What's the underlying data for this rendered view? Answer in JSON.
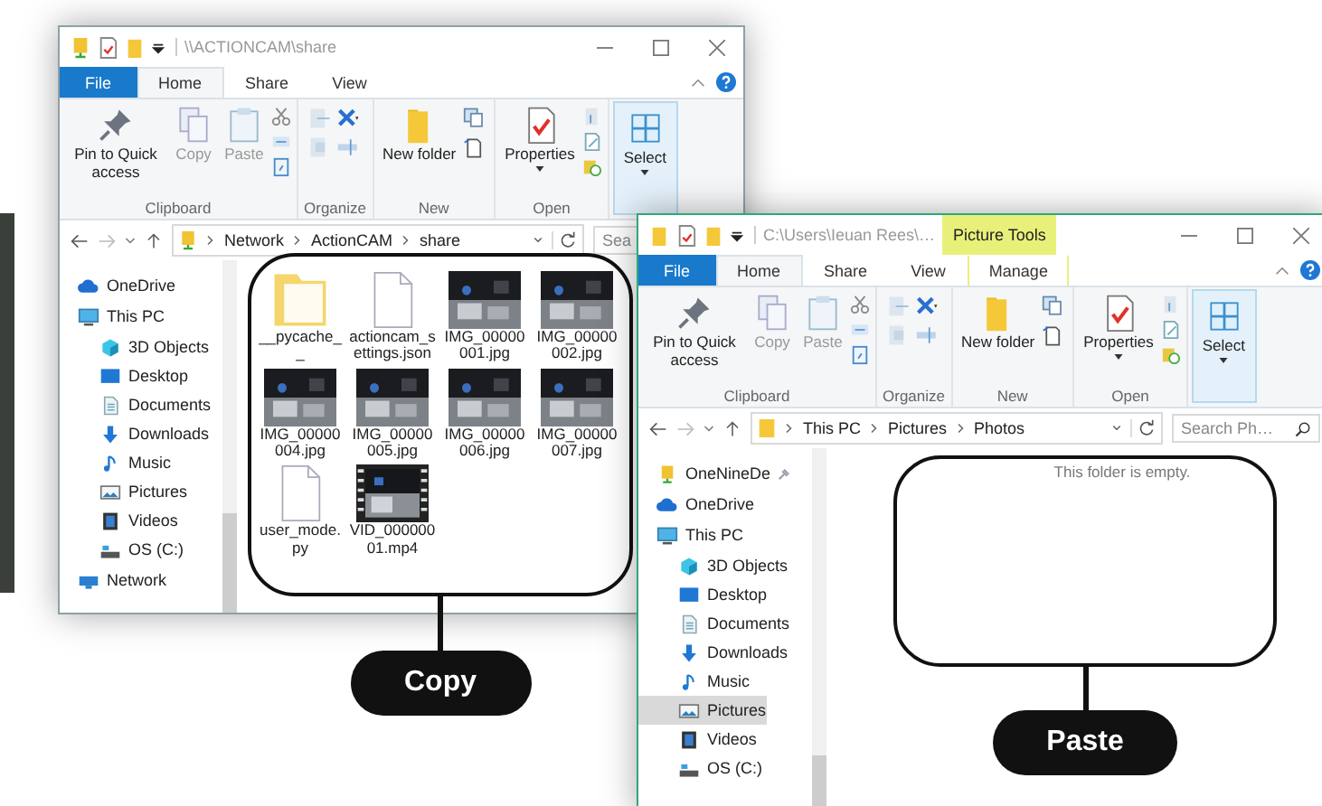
{
  "windows": [
    {
      "title": "\\\\ACTIONCAM\\share",
      "tabs": [
        {
          "label": "File",
          "kind": "file",
          "selected": false
        },
        {
          "label": "Home",
          "kind": "tab",
          "selected": true
        },
        {
          "label": "Share",
          "kind": "tab",
          "selected": false
        },
        {
          "label": "View",
          "kind": "tab",
          "selected": false
        }
      ],
      "ribbon": [
        {
          "kind": "clipboard",
          "label": "Clipboard",
          "commands": [
            {
              "label": "Pin to Quick access",
              "disabled": false
            },
            {
              "label": "Copy",
              "disabled": true
            },
            {
              "label": "Paste",
              "disabled": true
            }
          ]
        },
        {
          "kind": "organize",
          "label": "Organize"
        },
        {
          "kind": "new",
          "label": "New",
          "commands": [
            {
              "label": "New folder",
              "disabled": false
            }
          ]
        },
        {
          "kind": "open",
          "label": "Open",
          "commands": [
            {
              "label": "Properties",
              "disabled": false
            }
          ]
        },
        {
          "kind": "select",
          "commands": [
            {
              "label": "Select",
              "disabled": false
            }
          ]
        }
      ],
      "address": {
        "crumbs": [
          "Network",
          "ActionCAM",
          "share"
        ]
      },
      "search": {
        "placeholder": "Sea"
      },
      "sidebar": [
        {
          "label": "OneDrive",
          "kind": "cloud",
          "selected": false
        },
        {
          "label": "This PC",
          "kind": "computer",
          "selected": false,
          "children": [
            {
              "label": "3D Objects",
              "kind": "cube",
              "selected": false
            },
            {
              "label": "Desktop",
              "kind": "desktop",
              "selected": false
            },
            {
              "label": "Documents",
              "kind": "document",
              "selected": false
            },
            {
              "label": "Downloads",
              "kind": "download",
              "selected": false
            },
            {
              "label": "Music",
              "kind": "music",
              "selected": false
            },
            {
              "label": "Pictures",
              "kind": "pictures",
              "selected": false
            },
            {
              "label": "Videos",
              "kind": "videos",
              "selected": false
            },
            {
              "label": "OS (C:)",
              "kind": "drive",
              "selected": false
            }
          ]
        },
        {
          "label": "Network",
          "kind": "network",
          "selected": false
        }
      ],
      "files": [
        {
          "name": "__pycache__",
          "kind": "folder"
        },
        {
          "name": "actioncam_settings.json",
          "kind": "file"
        },
        {
          "name": "IMG_00000001.jpg"
        },
        {
          "name": "IMG_00000002.jpg"
        },
        {
          "name": "IMG_00000004.jpg"
        },
        {
          "name": "IMG_00000005.jpg"
        },
        {
          "name": "IMG_00000006.jpg"
        },
        {
          "name": "IMG_00000007.jpg"
        },
        {
          "name": "user_mode.py",
          "kind": "file"
        },
        {
          "name": "VID_00000001.mp4",
          "kind": "video"
        }
      ],
      "callout": {
        "label": "Copy"
      }
    },
    {
      "title": "C:\\Users\\Ieuan Rees\\…",
      "context_label": "Picture Tools",
      "tabs": [
        {
          "label": "File",
          "kind": "file",
          "selected": false
        },
        {
          "label": "Home",
          "kind": "tab",
          "selected": true
        },
        {
          "label": "Share",
          "kind": "tab",
          "selected": false
        },
        {
          "label": "View",
          "kind": "tab",
          "selected": false
        },
        {
          "label": "Manage",
          "kind": "context",
          "selected": false
        }
      ],
      "ribbon": [
        {
          "kind": "clipboard",
          "label": "Clipboard",
          "commands": [
            {
              "label": "Pin to Quick access",
              "disabled": false
            },
            {
              "label": "Copy",
              "disabled": true
            },
            {
              "label": "Paste",
              "disabled": true
            }
          ]
        },
        {
          "kind": "organize",
          "label": "Organize"
        },
        {
          "kind": "new",
          "label": "New",
          "commands": [
            {
              "label": "New folder",
              "disabled": false
            }
          ]
        },
        {
          "kind": "open",
          "label": "Open",
          "commands": [
            {
              "label": "Properties",
              "disabled": false
            }
          ]
        },
        {
          "kind": "select",
          "commands": [
            {
              "label": "Select",
              "disabled": false
            }
          ]
        }
      ],
      "address": {
        "crumbs": [
          "This PC",
          "Pictures",
          "Photos"
        ]
      },
      "search": {
        "placeholder": "Search Ph…"
      },
      "sidebar": [
        {
          "label": "OneNineDe",
          "kind": "pinned",
          "selected": false
        },
        {
          "label": "OneDrive",
          "kind": "cloud",
          "selected": false
        },
        {
          "label": "This PC",
          "kind": "computer",
          "selected": false,
          "children": [
            {
              "label": "3D Objects",
              "kind": "cube",
              "selected": false
            },
            {
              "label": "Desktop",
              "kind": "desktop",
              "selected": false
            },
            {
              "label": "Documents",
              "kind": "document",
              "selected": false
            },
            {
              "label": "Downloads",
              "kind": "download",
              "selected": false
            },
            {
              "label": "Music",
              "kind": "music",
              "selected": false
            },
            {
              "label": "Pictures",
              "kind": "pictures",
              "selected": true
            },
            {
              "label": "Videos",
              "kind": "videos",
              "selected": false
            },
            {
              "label": "OS (C:)",
              "kind": "drive",
              "selected": false
            }
          ]
        }
      ],
      "empty_text": "This folder is empty.",
      "callout": {
        "label": "Paste"
      }
    }
  ]
}
